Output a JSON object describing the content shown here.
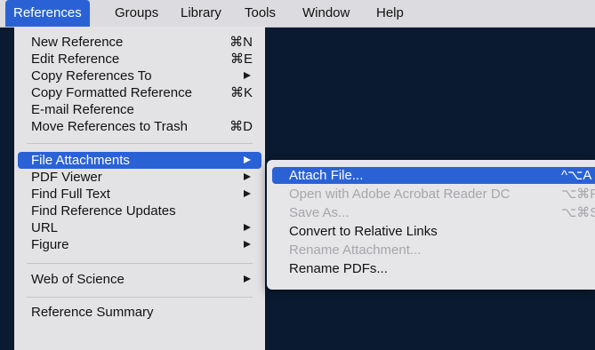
{
  "menubar": {
    "items": [
      "References",
      "Groups",
      "Library",
      "Tools",
      "Window",
      "Help"
    ]
  },
  "main_menu": {
    "new_reference": {
      "label": "New Reference",
      "shortcut": "⌘N"
    },
    "edit_reference": {
      "label": "Edit Reference",
      "shortcut": "⌘E"
    },
    "copy_references_to": {
      "label": "Copy References To"
    },
    "copy_formatted_reference": {
      "label": "Copy Formatted Reference",
      "shortcut": "⌘K"
    },
    "email_reference": {
      "label": "E-mail Reference"
    },
    "move_to_trash": {
      "label": "Move References to Trash",
      "shortcut": "⌘D"
    },
    "file_attachments": {
      "label": "File Attachments"
    },
    "pdf_viewer": {
      "label": "PDF Viewer"
    },
    "find_full_text": {
      "label": "Find Full Text"
    },
    "find_reference_updates": {
      "label": "Find Reference Updates"
    },
    "url": {
      "label": "URL"
    },
    "figure": {
      "label": "Figure"
    },
    "web_of_science": {
      "label": "Web of Science"
    },
    "reference_summary": {
      "label": "Reference Summary"
    }
  },
  "sub_menu": {
    "attach_file": {
      "label": "Attach File...",
      "shortcut": "^⌥A"
    },
    "open_with_acrobat": {
      "label": "Open with Adobe Acrobat Reader DC",
      "shortcut": "⌥⌘P"
    },
    "save_as": {
      "label": "Save As...",
      "shortcut": "⌥⌘S"
    },
    "convert_relative": {
      "label": "Convert to Relative Links"
    },
    "rename_attachment": {
      "label": "Rename Attachment..."
    },
    "rename_pdfs": {
      "label": "Rename PDFs..."
    }
  }
}
